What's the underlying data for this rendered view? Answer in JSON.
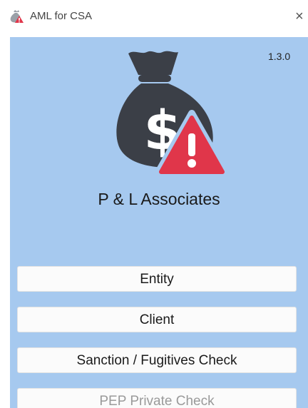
{
  "window": {
    "title": "AML for CSA",
    "close_glyph": "×",
    "app_icon": "money-bag-warning-icon"
  },
  "header": {
    "version": "1.3.0",
    "logo_icon": "money-bag-warning-icon",
    "company_name": "P & L Associates"
  },
  "menu": {
    "items": [
      {
        "label": "Entity"
      },
      {
        "label": "Client"
      },
      {
        "label": "Sanction / Fugitives Check"
      },
      {
        "label": "PEP Private Check"
      }
    ]
  },
  "colors": {
    "background": "#a6c9ef",
    "bag": "#3b3f47",
    "warning": "#e0364a",
    "button": "#fbfbfb"
  }
}
